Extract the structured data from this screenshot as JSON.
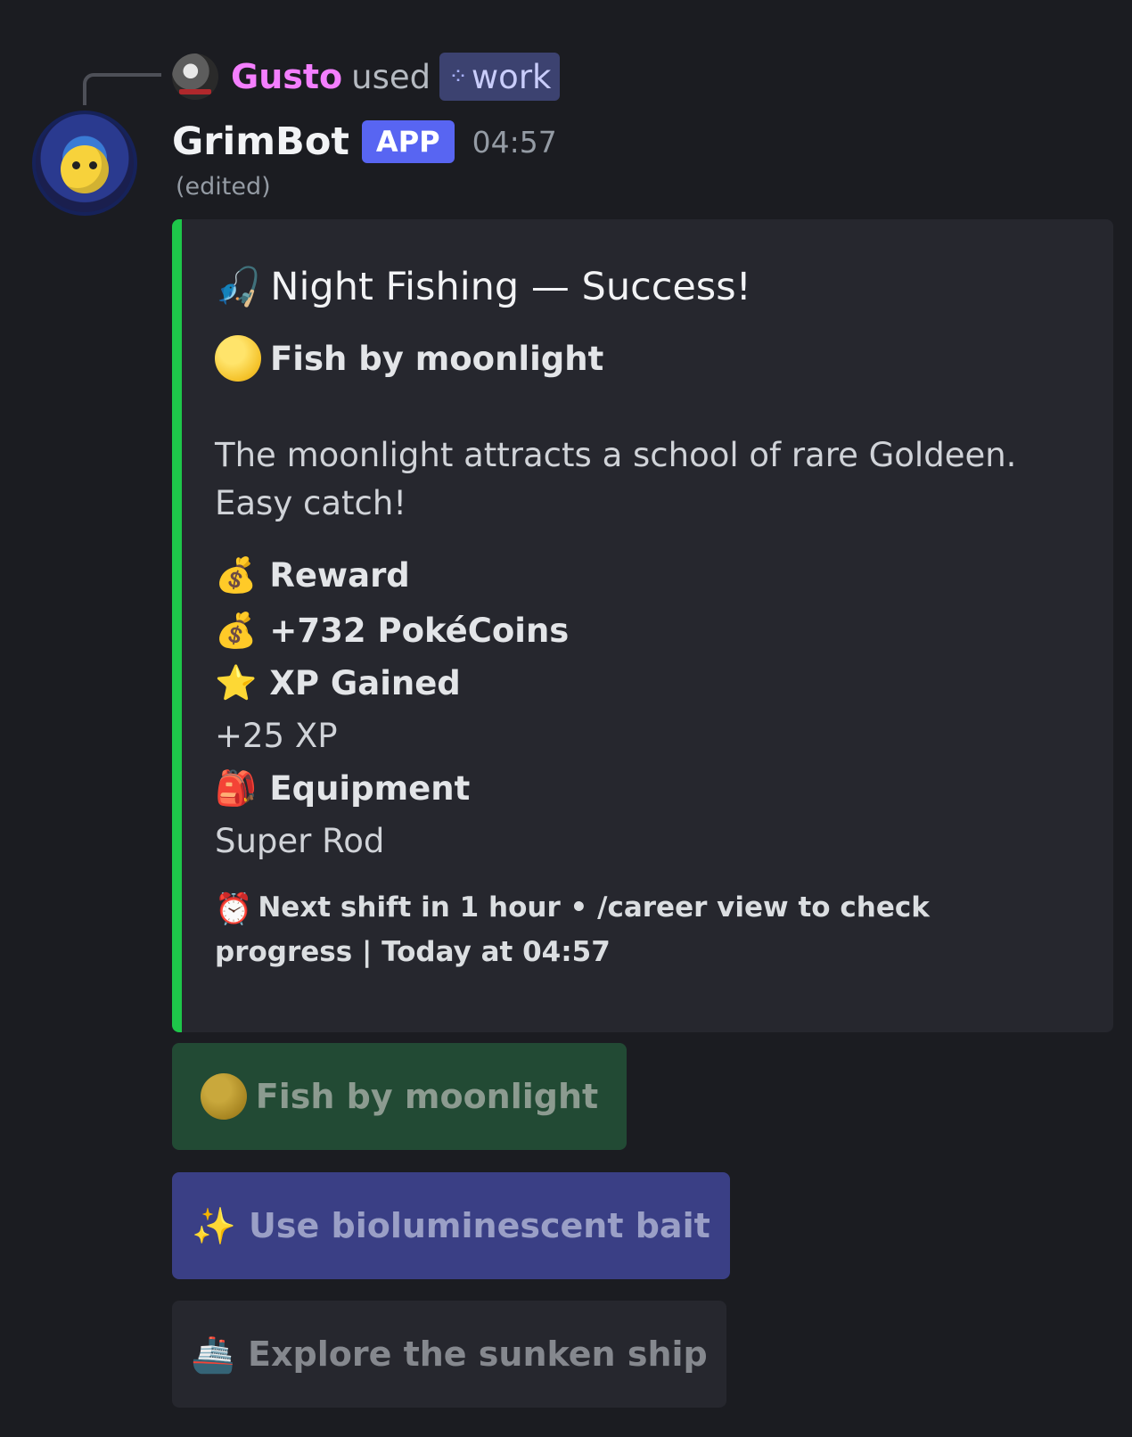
{
  "reply": {
    "user": "Gusto",
    "used": "used",
    "command": "work",
    "command_icon": "apps-icon"
  },
  "message": {
    "bot_name": "GrimBot",
    "badge": "APP",
    "time": "04:57",
    "edited": "(edited)"
  },
  "embed": {
    "accent_color": "#1ec64a",
    "title_emoji": "🎣",
    "title": "Night Fishing — Success!",
    "choice_emoji": "moon-icon",
    "choice": "Fish by moonlight",
    "description": "The moonlight attracts a school of rare Goldeen. Easy catch!",
    "fields": [
      {
        "emoji": "💰",
        "name": "Reward"
      },
      {
        "emoji": "💰",
        "name": "+732 PokéCoins"
      },
      {
        "emoji": "⭐",
        "name": "XP Gained",
        "value": "+25 XP"
      },
      {
        "emoji": "🎒",
        "name": "Equipment",
        "value": "Super Rod"
      }
    ],
    "footer_emoji": "⏰",
    "footer": "Next shift in 1 hour • /career view to check progress | Today at 04:57"
  },
  "buttons": [
    {
      "label": "Fish by moonlight",
      "icon": "moon-icon",
      "color": "#224a34"
    },
    {
      "label": "Use bioluminescent bait",
      "icon": "✨",
      "color": "#3a3f85"
    },
    {
      "label": "Explore the sunken ship",
      "icon": "🚢",
      "color": "#26272e"
    }
  ]
}
